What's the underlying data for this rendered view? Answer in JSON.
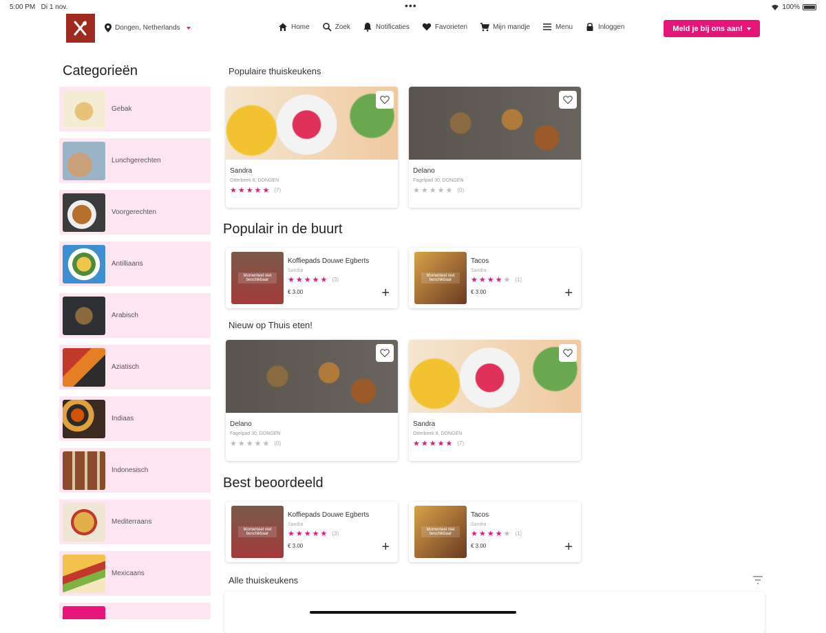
{
  "status_bar": {
    "time": "5:00 PM",
    "date": "Di 1 nov.",
    "battery": "100%"
  },
  "header": {
    "location": "Dongen, Netherlands",
    "nav": [
      {
        "label": "Home",
        "icon": "home-icon"
      },
      {
        "label": "Zoek",
        "icon": "search-icon"
      },
      {
        "label": "Notificaties",
        "icon": "bell-icon"
      },
      {
        "label": "Favorieten",
        "icon": "heart-icon"
      },
      {
        "label": "Mijn mandje",
        "icon": "cart-icon"
      },
      {
        "label": "Menu",
        "icon": "menu-icon"
      },
      {
        "label": "Inloggen",
        "icon": "lock-icon"
      }
    ],
    "cta": "Meld je bij ons aan!"
  },
  "sidebar": {
    "title": "Categorieën",
    "items": [
      {
        "label": "Gebak"
      },
      {
        "label": "Lunchgerechten"
      },
      {
        "label": "Voorgerechten"
      },
      {
        "label": "Antilliaans"
      },
      {
        "label": "Arabisch"
      },
      {
        "label": "Aziatisch"
      },
      {
        "label": "Indiaas"
      },
      {
        "label": "Indonesisch"
      },
      {
        "label": "Mediterraans"
      },
      {
        "label": "Mexicaans"
      },
      {
        "label": ""
      }
    ]
  },
  "sections": {
    "popular_kitchens": {
      "title": "Populaire thuiskeukens",
      "cards": [
        {
          "name": "Sandra",
          "address": "Otterbeek 8, DONGEN",
          "rating": 5,
          "count": "(7)"
        },
        {
          "name": "Delano",
          "address": "Fagelpad 30, DONGEN",
          "rating": 0,
          "count": "(0)"
        }
      ]
    },
    "popular_nearby": {
      "title": "Populair in de buurt",
      "products": [
        {
          "name": "Koffiepads Douwe Egberts",
          "seller": "Sandra",
          "rating": 5,
          "count": "(3)",
          "price": "€ 3.00",
          "img_text": "Momenteel niet beschikbaar"
        },
        {
          "name": "Tacos",
          "seller": "Sandra",
          "rating": 4,
          "count": "(1)",
          "price": "€ 3.00",
          "img_text": "Momenteel niet beschikbaar"
        }
      ]
    },
    "new": {
      "title": "Nieuw op Thuis eten!",
      "cards": [
        {
          "name": "Delano",
          "address": "Fagelpad 30, DONGEN",
          "rating": 0,
          "count": "(0)"
        },
        {
          "name": "Sandra",
          "address": "Otterbeek 8, DONGEN",
          "rating": 5,
          "count": "(7)"
        }
      ]
    },
    "best_rated": {
      "title": "Best beoordeeld",
      "products": [
        {
          "name": "Koffiepads Douwe Egberts",
          "seller": "Sandra",
          "rating": 5,
          "count": "(3)",
          "price": "€ 3.00",
          "img_text": "Momenteel niet beschikbaar"
        },
        {
          "name": "Tacos",
          "seller": "Sandra",
          "rating": 4,
          "count": "(1)",
          "price": "€ 3.00",
          "img_text": "Momenteel niet beschikbaar"
        }
      ]
    },
    "all_kitchens": {
      "title": "Alle thuiskeukens"
    }
  },
  "colors": {
    "accent": "#e5157a",
    "logo_bg": "#a02a20",
    "category_bg": "#fde6f1"
  }
}
